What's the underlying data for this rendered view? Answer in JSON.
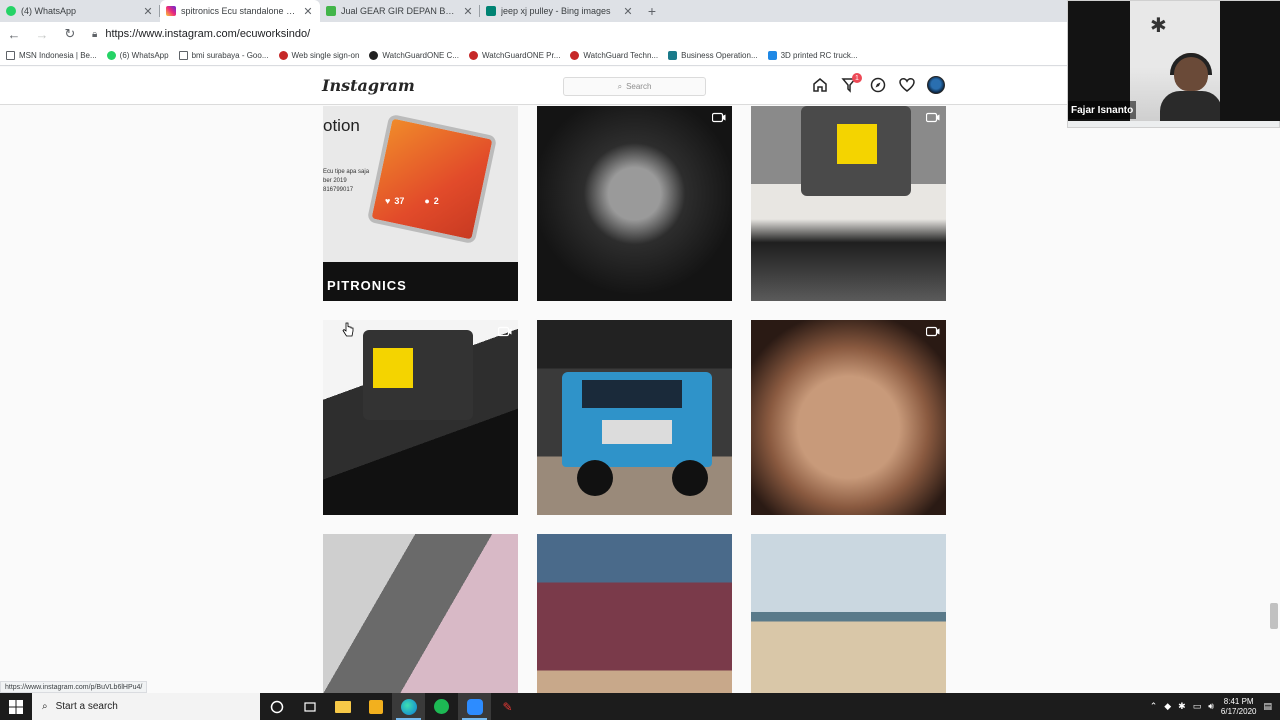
{
  "tabs": [
    {
      "label": "(4) WhatsApp",
      "color": "#25d366"
    },
    {
      "label": "spitronics Ecu standalone (@ecu",
      "color": "#d6249f",
      "active": true
    },
    {
      "label": "Jual GEAR GIR DEPAN BELAKAN",
      "color": "#42b549"
    },
    {
      "label": "jeep xj pulley - Bing images",
      "color": "#008373"
    }
  ],
  "browser": {
    "url": "https://www.instagram.com/ecuworksindo/",
    "status_url": "https://www.instagram.com/p/BuVLb6lHPu4/"
  },
  "bookmarks": [
    {
      "label": "MSN Indonesia | Be...",
      "color": "#ffffff"
    },
    {
      "label": "(6) WhatsApp",
      "color": "#25d366"
    },
    {
      "label": "bmi surabaya - Goo...",
      "color": "#ffffff"
    },
    {
      "label": "Web single sign-on",
      "color": "#c62828"
    },
    {
      "label": "WatchGuardONE C...",
      "color": "#222222"
    },
    {
      "label": "WatchGuardONE Pr...",
      "color": "#c62828"
    },
    {
      "label": "WatchGuard Techn...",
      "color": "#c62828"
    },
    {
      "label": "Business Operation...",
      "color": "#1a7a8a"
    },
    {
      "label": "3D printed RC truck...",
      "color": "#1e88e5"
    }
  ],
  "instagram": {
    "logo": "Instagram",
    "search_placeholder": "Search",
    "notification_count": "1"
  },
  "posts": [
    {
      "kind": "ecu",
      "heading": "otion",
      "sub": "Ecu tipe apa saja\nber 2019\n816799017",
      "brand": "PITRONICS",
      "likes": "37",
      "comments": "2",
      "video": false
    },
    {
      "kind": "engine",
      "video": true
    },
    {
      "kind": "printer",
      "video": true
    },
    {
      "kind": "printer2",
      "video": true
    },
    {
      "kind": "car",
      "video": false
    },
    {
      "kind": "face",
      "video": true
    },
    {
      "kind": "people",
      "video": false
    },
    {
      "kind": "family",
      "video": false
    },
    {
      "kind": "beach",
      "video": false
    }
  ],
  "webcam": {
    "name": "Fajar Isnanto"
  },
  "taskbar": {
    "search_placeholder": "Start a search",
    "time": "8:41 PM",
    "date": "6/17/2020"
  }
}
